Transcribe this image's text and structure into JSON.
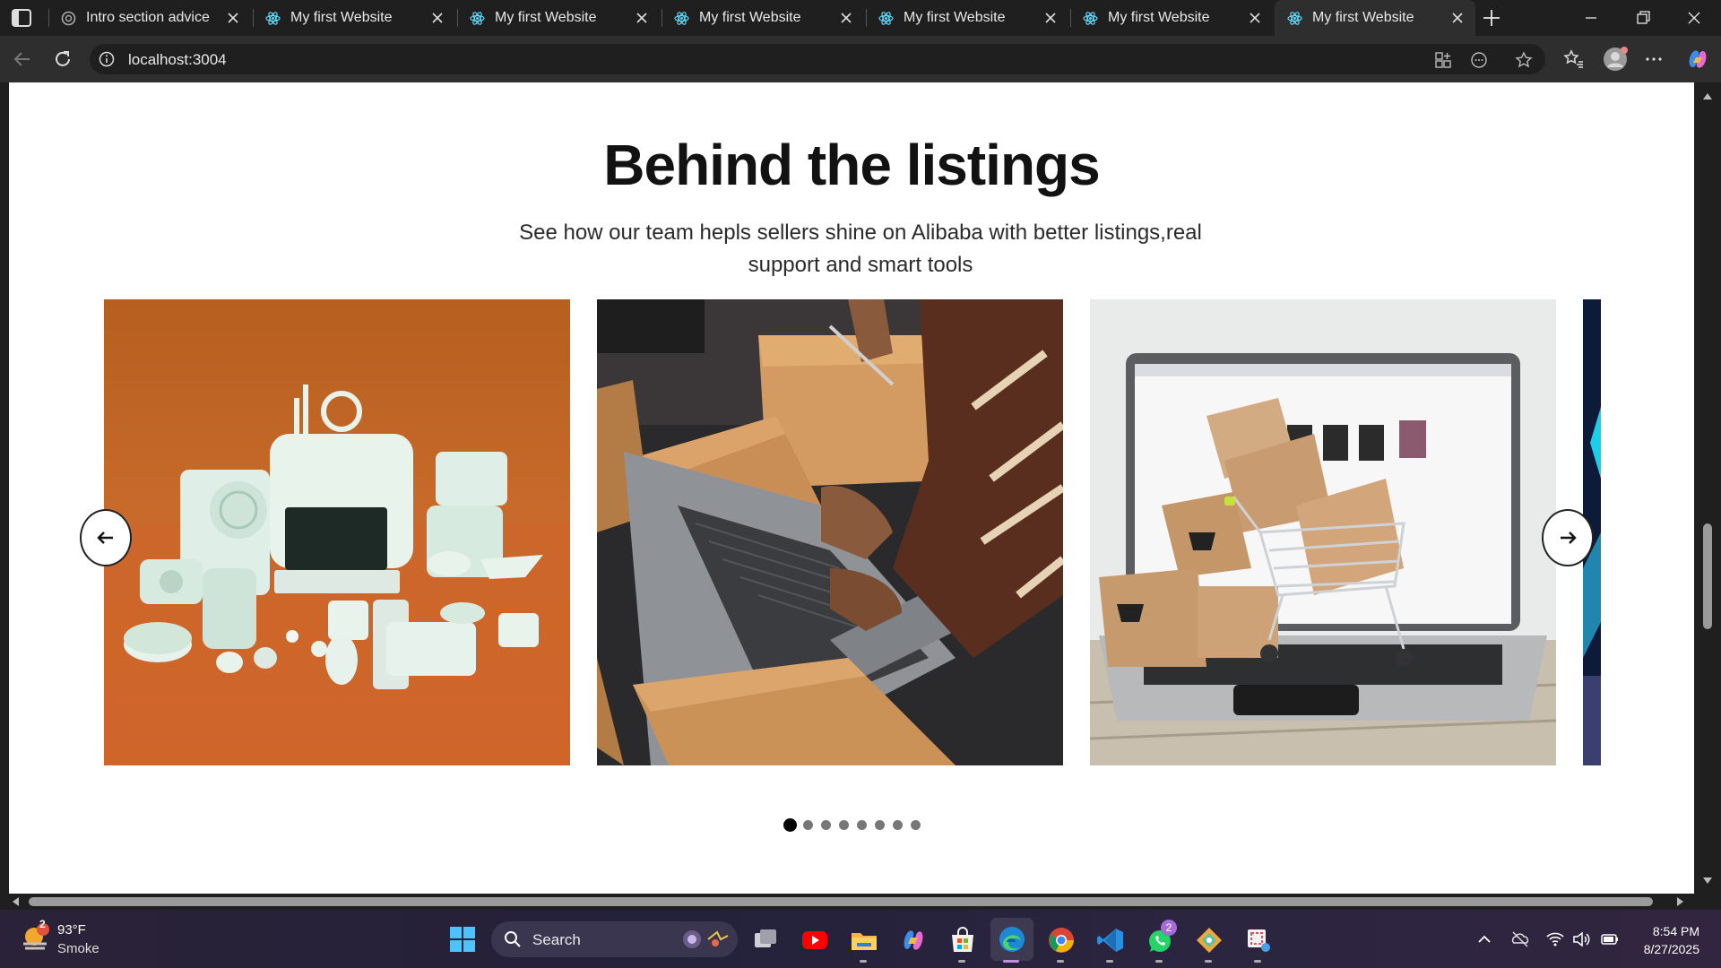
{
  "browser": {
    "tabs": [
      {
        "title": "Intro section advice",
        "active": false
      },
      {
        "title": "My first Website",
        "active": false
      },
      {
        "title": "My first Website",
        "active": false
      },
      {
        "title": "My first Website",
        "active": false
      },
      {
        "title": "My first Website",
        "active": false
      },
      {
        "title": "My first Website",
        "active": false
      },
      {
        "title": "My first Website",
        "active": true
      }
    ],
    "url": "localhost:3004"
  },
  "page": {
    "heading": "Behind the listings",
    "subtitle": "See how our team hepls sellers shine on Alibaba with better listings,real support and smart tools",
    "carousel": {
      "slides": [
        "electronic-gadgets-photo",
        "packing-boxes-laptop-photo",
        "laptop-cart-boxes-photo",
        "partial-fourth-slide"
      ],
      "dot_count": 8,
      "active_dot": 0
    }
  },
  "taskbar": {
    "weather": {
      "temp": "93°F",
      "condition": "Smoke",
      "badge": "2"
    },
    "search_label": "Search",
    "whatsapp_badge": "2",
    "time": "8:54 PM",
    "date": "8/27/2025"
  },
  "colors": {
    "accent_edge": "#2a7fd4",
    "page_bg": "#ffffff",
    "chrome_bg": "#1f1f1f"
  }
}
